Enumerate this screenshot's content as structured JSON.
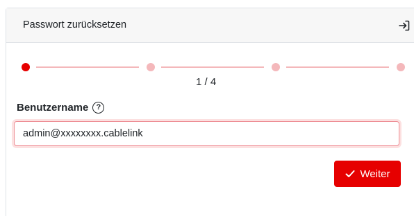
{
  "header": {
    "title": "Passwort zurücksetzen",
    "logout_icon": "logout-icon"
  },
  "stepper": {
    "current_step": 1,
    "total_steps": 4,
    "label": "1 / 4",
    "active_color": "#e60000",
    "inactive_color": "#f4b8bb"
  },
  "form": {
    "username_label": "Benutzername",
    "help_icon": "question-circle-icon",
    "help_glyph": "?",
    "username_value": "admin@xxxxxxxx.cablelink"
  },
  "actions": {
    "submit_label": "Weiter",
    "submit_icon": "check-icon",
    "accent_color": "#e60000"
  }
}
